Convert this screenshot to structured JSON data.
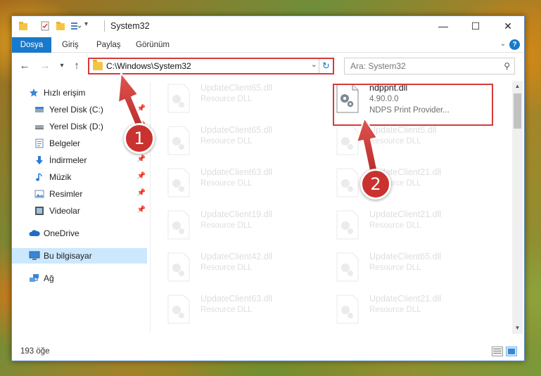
{
  "window": {
    "title": "System32",
    "controls": {
      "minimize": "—",
      "maximize": "☐",
      "close": "✕"
    }
  },
  "ribbon": {
    "file_tab": "Dosya",
    "tabs": [
      "Giriş",
      "Paylaş",
      "Görünüm"
    ]
  },
  "navigation": {
    "address": "C:\\Windows\\System32",
    "search_placeholder": "Ara: System32"
  },
  "sidebar": {
    "items": [
      {
        "label": "Hızlı erişim",
        "icon": "star-icon",
        "pinned": false
      },
      {
        "label": "Yerel Disk (C:)",
        "icon": "drive-icon",
        "pinned": true
      },
      {
        "label": "Yerel Disk (D:)",
        "icon": "drive-icon",
        "pinned": true
      },
      {
        "label": "Belgeler",
        "icon": "documents-icon",
        "pinned": true
      },
      {
        "label": "İndirmeler",
        "icon": "download-icon",
        "pinned": true
      },
      {
        "label": "Müzik",
        "icon": "music-icon",
        "pinned": true
      },
      {
        "label": "Resimler",
        "icon": "pictures-icon",
        "pinned": true
      },
      {
        "label": "Videolar",
        "icon": "video-icon",
        "pinned": true
      },
      {
        "label": "OneDrive",
        "icon": "cloud-icon",
        "pinned": false
      },
      {
        "label": "Bu bilgisayar",
        "icon": "computer-icon",
        "pinned": false,
        "selected": true
      },
      {
        "label": "Ağ",
        "icon": "network-icon",
        "pinned": false
      }
    ]
  },
  "files": {
    "left_column": [
      {
        "name": "UpdateClient65.dll",
        "type": "Resource DLL"
      },
      {
        "name": "UpdateClient65.dll",
        "type": "Resource DLL"
      },
      {
        "name": "UpdateClient63.dll",
        "type": "Resource DLL"
      },
      {
        "name": "UpdateClient19.dll",
        "type": "Resource DLL"
      },
      {
        "name": "UpdateClient42.dll",
        "type": "Resource DLL"
      },
      {
        "name": "UpdateClient63.dll",
        "type": "Resource DLL"
      }
    ],
    "right_column": [
      {
        "name": "ndppnt.dll",
        "version": "4.90.0.0",
        "description": "NDPS Print Provider..."
      },
      {
        "name": "UpdateClient5.dll",
        "type": "Resource DLL"
      },
      {
        "name": "UpdateClient21.dll",
        "type": "Resource DLL"
      },
      {
        "name": "UpdateClient21.dll",
        "type": "Resource DLL"
      },
      {
        "name": "UpdateClient65.dll",
        "type": "Resource DLL"
      },
      {
        "name": "UpdateClient21.dll",
        "type": "Resource DLL"
      }
    ]
  },
  "status": {
    "count": "193 öğe"
  },
  "annotations": {
    "step1": "1",
    "step2": "2",
    "color": "#c9322f"
  }
}
